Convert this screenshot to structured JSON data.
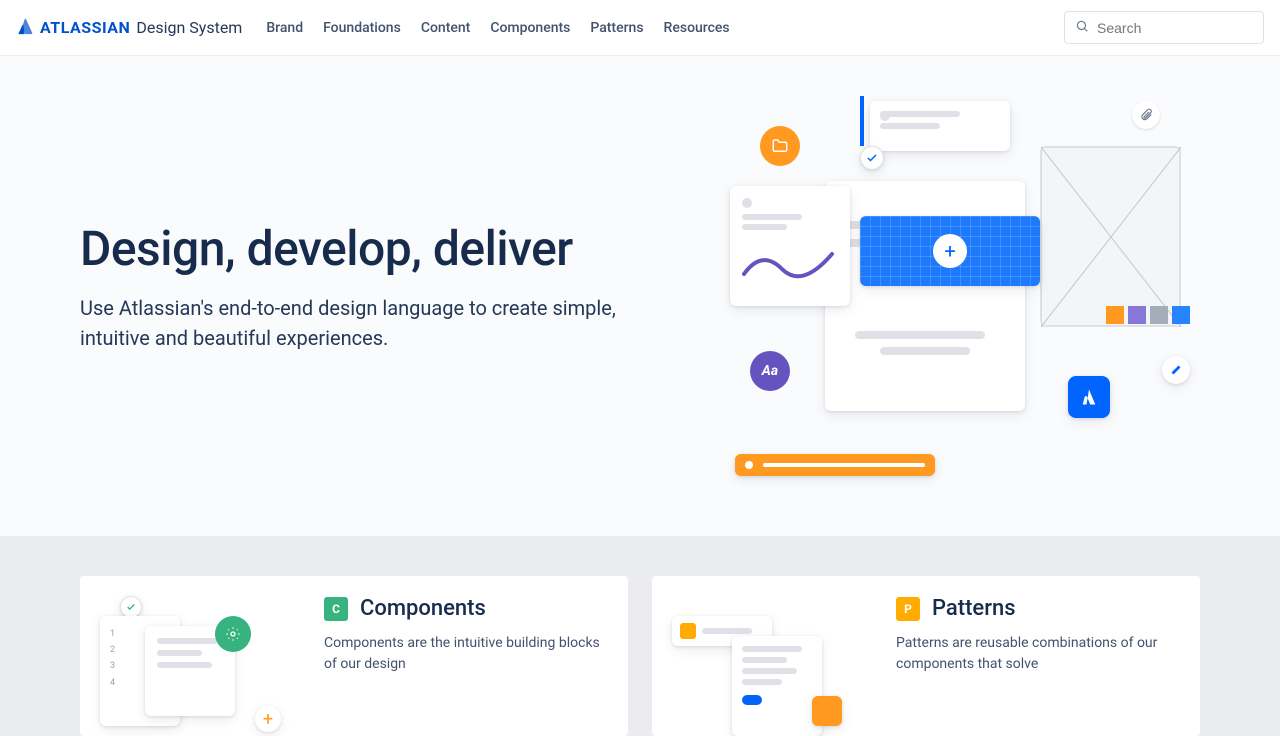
{
  "header": {
    "brand": "ATLASSIAN",
    "suffix": "Design System",
    "nav": [
      "Brand",
      "Foundations",
      "Content",
      "Components",
      "Patterns",
      "Resources"
    ],
    "search_placeholder": "Search"
  },
  "hero": {
    "title": "Design, develop, deliver",
    "subtitle": "Use Atlassian's end-to-end design language to create simple, intuitive and beautiful experiences."
  },
  "cards": [
    {
      "badge": "C",
      "badge_color": "#36B37E",
      "title": "Components",
      "desc": "Components are the intuitive building blocks of our design"
    },
    {
      "badge": "P",
      "badge_color": "#FFAB00",
      "title": "Patterns",
      "desc": "Patterns are reusable combinations of our components that solve"
    }
  ]
}
